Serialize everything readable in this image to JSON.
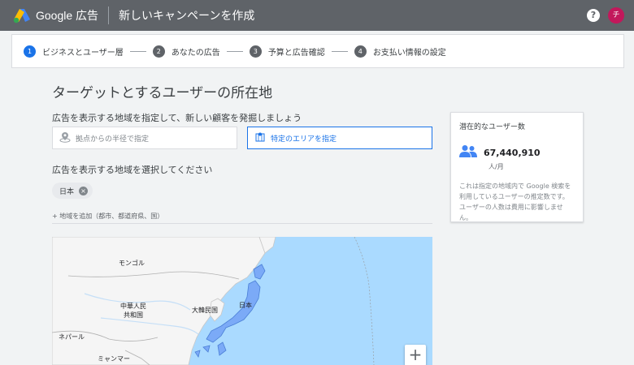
{
  "app": {
    "product_name": "Google 広告",
    "page_title": "新しいキャンペーンを作成",
    "help_icon": "?",
    "avatar_initial": "チ"
  },
  "stepper": {
    "steps": [
      {
        "num": "1",
        "label": "ビジネスとユーザー層",
        "active": true
      },
      {
        "num": "2",
        "label": "あなたの広告",
        "active": false
      },
      {
        "num": "3",
        "label": "予算と広告確認",
        "active": false
      },
      {
        "num": "4",
        "label": "お支払い情報の設定",
        "active": false
      }
    ]
  },
  "main": {
    "title": "ターゲットとするユーザーの所在地",
    "method_label": "広告を表示する地域を指定して、新しい顧客を発掘しましょう",
    "option_radius": "拠点からの半径で指定",
    "option_area": "特定のエリアを指定",
    "select_label": "広告を表示する地域を選択してください",
    "chip_label": "日本",
    "add_region": "+ 地域を追加（都市、都道府県、国）"
  },
  "map": {
    "labels": {
      "mongolia": "モンゴル",
      "china": "中華人民\n共和国",
      "korea": "大韓民国",
      "japan": "日本",
      "nepal": "ネパール",
      "myanmar": "ミャンマー"
    },
    "zoom_in": "+"
  },
  "audience": {
    "title": "潜在的なユーザー数",
    "count": "67,440,910",
    "unit": "人/月",
    "note": "これは指定の地域内で Google 検索を利用しているユーザーの推定数です。ユーザーの人数は費用に影響しません。"
  },
  "colors": {
    "topbar": "#5f6368",
    "accent": "#1a73e8",
    "avatar": "#c2185b",
    "map_water": "#aadaff",
    "map_land": "#f5f5f5",
    "japan_fill": "#7baaf7"
  }
}
